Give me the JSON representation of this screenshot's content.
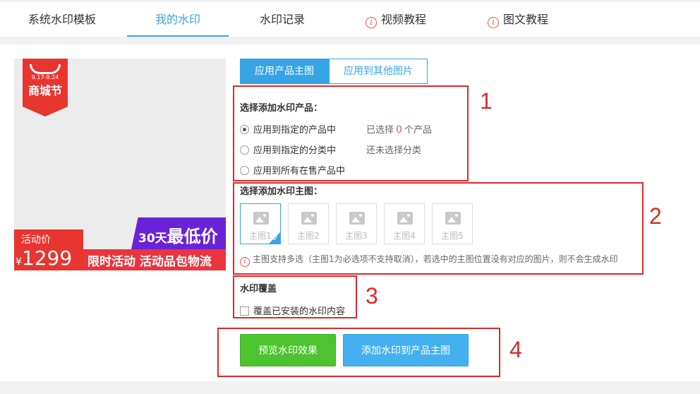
{
  "tabs": [
    {
      "label": "系统水印模板",
      "active": false
    },
    {
      "label": "我的水印",
      "active": true
    },
    {
      "label": "水印记录",
      "active": false
    },
    {
      "label": "视频教程",
      "active": false,
      "icon": "info-icon"
    },
    {
      "label": "图文教程",
      "active": false,
      "icon": "info-icon"
    }
  ],
  "preview": {
    "badge_date": "9.17-9.24",
    "badge_title": "商城节",
    "promo_days": "30天",
    "promo_lowest": "最低价",
    "price_label": "活动价",
    "price_currency": "¥",
    "price_value": "1299",
    "promo_banner": "限时活动 活动品包物流"
  },
  "apply_toggle": {
    "primary": "应用产品主图",
    "other": "应用到其他图片"
  },
  "section1": {
    "title": "选择添加水印产品：",
    "options": [
      {
        "label": "应用到指定的产品中",
        "checked": true
      },
      {
        "label": "应用到指定的分类中",
        "checked": false
      },
      {
        "label": "应用到所有在售产品中",
        "checked": false
      }
    ],
    "selected_prefix": "已选择",
    "selected_count": "0",
    "selected_suffix": "个产品",
    "no_category": "还未选择分类"
  },
  "section2": {
    "title": "选择添加水印主图：",
    "thumbs": [
      {
        "label": "主图1",
        "selected": true
      },
      {
        "label": "主图2",
        "selected": false
      },
      {
        "label": "主图3",
        "selected": false
      },
      {
        "label": "主图4",
        "selected": false
      },
      {
        "label": "主图5",
        "selected": false
      }
    ],
    "hint": "主图支持多选（主图1为必选项不支持取消），若选中的主图位置没有对应的图片，则不会生成水印"
  },
  "section3": {
    "title": "水印覆盖",
    "checkbox_label": "覆盖已安装的水印内容",
    "checked": false
  },
  "actions": {
    "preview_label": "预览水印效果",
    "apply_label": "添加水印到产品主图"
  },
  "annotations": [
    "1",
    "2",
    "3",
    "4"
  ],
  "colors": {
    "accent": "#37a4e4",
    "annotation": "#d92a2a",
    "green": "#4cc32f",
    "blue": "#45b0ef"
  }
}
